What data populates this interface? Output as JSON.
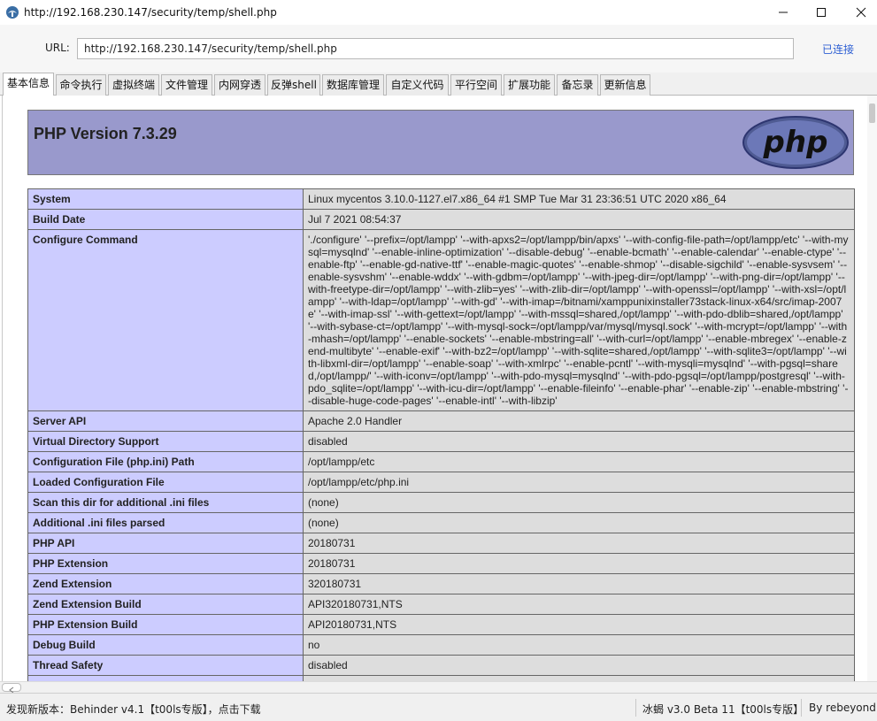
{
  "window": {
    "title": "http://192.168.230.147/security/temp/shell.php",
    "icons": {
      "app": "behinder-app-icon",
      "minimize": "minimize-icon",
      "maximize": "maximize-icon",
      "close": "close-icon"
    }
  },
  "urlbar": {
    "label": "URL:",
    "value": "http://192.168.230.147/security/temp/shell.php",
    "status": "已连接",
    "status_color": "#2d5fd3"
  },
  "tabs": [
    {
      "label": "基本信息",
      "active": true
    },
    {
      "label": "命令执行",
      "active": false
    },
    {
      "label": "虚拟终端",
      "active": false
    },
    {
      "label": "文件管理",
      "active": false
    },
    {
      "label": "内网穿透",
      "active": false
    },
    {
      "label": "反弹shell",
      "active": false
    },
    {
      "label": "数据库管理",
      "active": false
    },
    {
      "label": "自定义代码",
      "active": false
    },
    {
      "label": "平行空间",
      "active": false
    },
    {
      "label": "扩展功能",
      "active": false
    },
    {
      "label": "备忘录",
      "active": false
    },
    {
      "label": "更新信息",
      "active": false
    }
  ],
  "phpinfo": {
    "title": "PHP Version 7.3.29",
    "logo_text": "php",
    "colors": {
      "header": "#9999cc",
      "key_cell": "#ccccff",
      "value_cell": "#dddddd"
    },
    "rows": [
      {
        "key": "System",
        "value": "Linux mycentos 3.10.0-1127.el7.x86_64 #1 SMP Tue Mar 31 23:36:51 UTC 2020 x86_64"
      },
      {
        "key": "Build Date",
        "value": "Jul 7 2021 08:54:37"
      },
      {
        "key": "Configure Command",
        "value": "'./configure' '--prefix=/opt/lampp' '--with-apxs2=/opt/lampp/bin/apxs' '--with-config-file-path=/opt/lampp/etc' '--with-mysql=mysqlnd' '--enable-inline-optimization' '--disable-debug' '--enable-bcmath' '--enable-calendar' '--enable-ctype' '--enable-ftp' '--enable-gd-native-ttf' '--enable-magic-quotes' '--enable-shmop' '--disable-sigchild' '--enable-sysvsem' '--enable-sysvshm' '--enable-wddx' '--with-gdbm=/opt/lampp' '--with-jpeg-dir=/opt/lampp' '--with-png-dir=/opt/lampp' '--with-freetype-dir=/opt/lampp' '--with-zlib=yes' '--with-zlib-dir=/opt/lampp' '--with-openssl=/opt/lampp' '--with-xsl=/opt/lampp' '--with-ldap=/opt/lampp' '--with-gd' '--with-imap=/bitnami/xamppunixinstaller73stack-linux-x64/src/imap-2007e' '--with-imap-ssl' '--with-gettext=/opt/lampp' '--with-mssql=shared,/opt/lampp' '--with-pdo-dblib=shared,/opt/lampp' '--with-sybase-ct=/opt/lampp' '--with-mysql-sock=/opt/lampp/var/mysql/mysql.sock' '--with-mcrypt=/opt/lampp' '--with-mhash=/opt/lampp' '--enable-sockets' '--enable-mbstring=all' '--with-curl=/opt/lampp' '--enable-mbregex' '--enable-zend-multibyte' '--enable-exif' '--with-bz2=/opt/lampp' '--with-sqlite=shared,/opt/lampp' '--with-sqlite3=/opt/lampp' '--with-libxml-dir=/opt/lampp' '--enable-soap' '--with-xmlrpc' '--enable-pcntl' '--with-mysqli=mysqlnd' '--with-pgsql=shared,/opt/lampp/' '--with-iconv=/opt/lampp' '--with-pdo-mysql=mysqlnd' '--with-pdo-pgsql=/opt/lampp/postgresql' '--with-pdo_sqlite=/opt/lampp' '--with-icu-dir=/opt/lampp' '--enable-fileinfo' '--enable-phar' '--enable-zip' '--enable-mbstring' '--disable-huge-code-pages' '--enable-intl' '--with-libzip'"
      },
      {
        "key": "Server API",
        "value": "Apache 2.0 Handler"
      },
      {
        "key": "Virtual Directory Support",
        "value": "disabled"
      },
      {
        "key": "Configuration File (php.ini) Path",
        "value": "/opt/lampp/etc"
      },
      {
        "key": "Loaded Configuration File",
        "value": "/opt/lampp/etc/php.ini"
      },
      {
        "key": "Scan this dir for additional .ini files",
        "value": "(none)"
      },
      {
        "key": "Additional .ini files parsed",
        "value": "(none)"
      },
      {
        "key": "PHP API",
        "value": "20180731"
      },
      {
        "key": "PHP Extension",
        "value": "20180731"
      },
      {
        "key": "Zend Extension",
        "value": "320180731"
      },
      {
        "key": "Zend Extension Build",
        "value": "API320180731,NTS"
      },
      {
        "key": "PHP Extension Build",
        "value": "API20180731,NTS"
      },
      {
        "key": "Debug Build",
        "value": "no"
      },
      {
        "key": "Thread Safety",
        "value": "disabled"
      },
      {
        "key": "",
        "value": ""
      }
    ]
  },
  "statusbar": {
    "left": "发现新版本：Behinder v4.1【t00ls专版】，点击下载",
    "middle": "冰蝎 v3.0 Beta 11【t00ls专版】",
    "right": "By rebeyond"
  }
}
